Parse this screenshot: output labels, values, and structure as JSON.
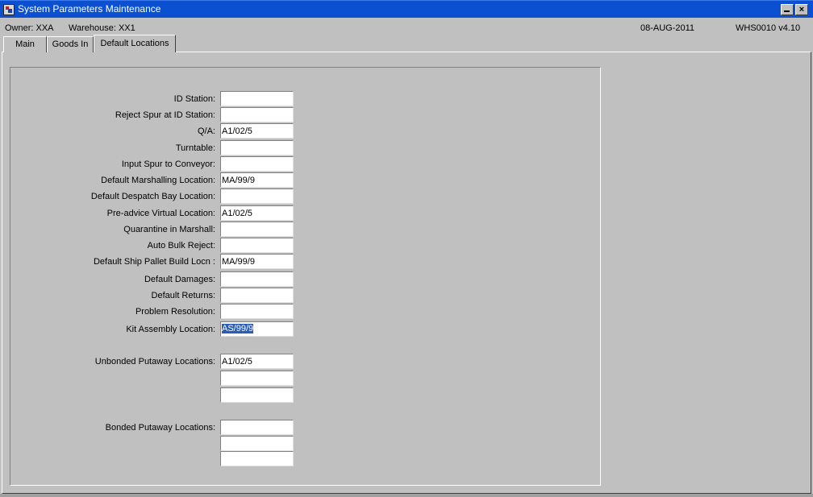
{
  "window": {
    "title": "System Parameters Maintenance",
    "minimize_icon": "minimize-icon",
    "close_glyph": "×"
  },
  "status": {
    "owner": "Owner:  XXA",
    "warehouse": "Warehouse:  XX1",
    "date": "08-AUG-2011",
    "version": "WHS0010  v4.10"
  },
  "tabs": [
    {
      "label": "Main"
    },
    {
      "label": "Goods In"
    },
    {
      "label": "Default Locations"
    }
  ],
  "fields": {
    "id_station": {
      "label": "ID Station:",
      "value": ""
    },
    "reject_spur": {
      "label": "Reject Spur at ID Station:",
      "value": ""
    },
    "qa": {
      "label": "Q/A:",
      "value": "A1/02/5"
    },
    "turntable": {
      "label": "Turntable:",
      "value": ""
    },
    "input_spur": {
      "label": "Input Spur to Conveyor:",
      "value": ""
    },
    "marshalling": {
      "label": "Default Marshalling Location:",
      "value": "MA/99/9"
    },
    "despatch_bay": {
      "label": "Default Despatch Bay Location:",
      "value": ""
    },
    "pre_advice": {
      "label": "Pre-advice Virtual Location:",
      "value": "A1/02/5"
    },
    "quarantine": {
      "label": "Quarantine in Marshall:",
      "value": ""
    },
    "auto_bulk": {
      "label": "Auto Bulk Reject:",
      "value": ""
    },
    "ship_pallet": {
      "label": "Default Ship Pallet Build Locn :",
      "value": "MA/99/9"
    },
    "damages": {
      "label": "Default Damages:",
      "value": ""
    },
    "returns": {
      "label": "Default Returns:",
      "value": ""
    },
    "problem": {
      "label": "Problem Resolution:",
      "value": ""
    },
    "kit_assembly": {
      "label": "Kit Assembly Location:",
      "value": "AS/99/9"
    }
  },
  "unbonded": {
    "label": "Unbonded Putaway Locations:",
    "values": [
      "A1/02/5",
      "",
      ""
    ]
  },
  "bonded": {
    "label": "Bonded Putaway Locations:",
    "values": [
      "",
      "",
      ""
    ]
  }
}
